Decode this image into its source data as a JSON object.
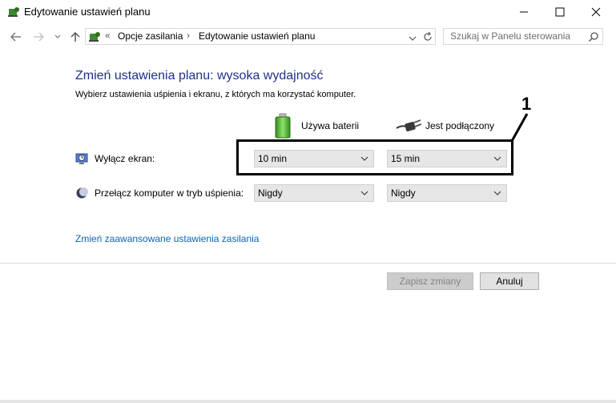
{
  "window": {
    "title": "Edytowanie ustawień planu",
    "minimize_glyph": "—",
    "maximize_glyph": "☐",
    "close_glyph": "✕"
  },
  "address": {
    "overflow_glyph": "«",
    "crumbs": [
      "Opcje zasilania",
      "Edytowanie ustawień planu"
    ],
    "separator": "›",
    "search_placeholder": "Szukaj w Panelu sterowania"
  },
  "content": {
    "heading": "Zmień ustawienia planu: wysoka wydajność",
    "subtitle": "Wybierz ustawienia uśpienia i ekranu, z których ma korzystać komputer.",
    "columns": {
      "battery": "Używa baterii",
      "plugged": "Jest podłączony"
    },
    "rows": [
      {
        "label": "Wyłącz ekran:",
        "battery_value": "10 min",
        "plugged_value": "15 min"
      },
      {
        "label": "Przełącz komputer w tryb uśpienia:",
        "battery_value": "Nigdy",
        "plugged_value": "Nigdy"
      }
    ],
    "advanced_link": "Zmień zaawansowane ustawienia zasilania"
  },
  "buttons": {
    "save": "Zapisz zmiany",
    "cancel": "Anuluj"
  },
  "annotation": {
    "number": "1"
  },
  "colors": {
    "heading": "#1e3287",
    "link": "#0b63b5",
    "dropdown_bg": "#e6e6e6"
  },
  "icons": [
    "power-options-icon",
    "back-arrow-icon",
    "forward-arrow-icon",
    "recent-dropdown-icon",
    "up-arrow-icon",
    "refresh-icon",
    "search-icon",
    "battery-icon",
    "plug-icon",
    "display-clock-icon",
    "moon-icon",
    "chevron-down-icon"
  ]
}
